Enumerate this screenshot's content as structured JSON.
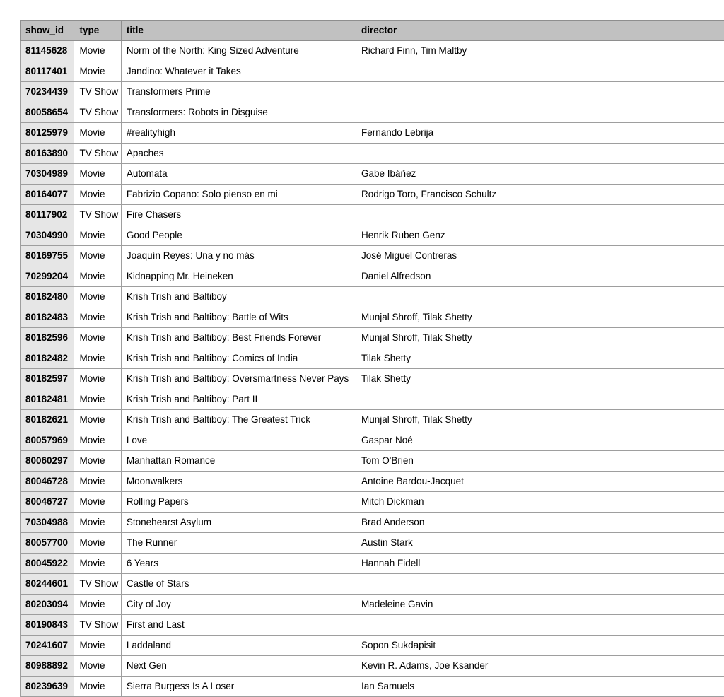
{
  "columns": [
    "show_id",
    "type",
    "title",
    "director"
  ],
  "rows": [
    {
      "show_id": "81145628",
      "type": "Movie",
      "title": "Norm of the North: King Sized Adventure",
      "director": "Richard Finn, Tim Maltby"
    },
    {
      "show_id": "80117401",
      "type": "Movie",
      "title": "Jandino: Whatever it Takes",
      "director": ""
    },
    {
      "show_id": "70234439",
      "type": "TV Show",
      "title": "Transformers Prime",
      "director": ""
    },
    {
      "show_id": "80058654",
      "type": "TV Show",
      "title": "Transformers: Robots in Disguise",
      "director": ""
    },
    {
      "show_id": "80125979",
      "type": "Movie",
      "title": "#realityhigh",
      "director": "Fernando Lebrija"
    },
    {
      "show_id": "80163890",
      "type": "TV Show",
      "title": "Apaches",
      "director": ""
    },
    {
      "show_id": "70304989",
      "type": "Movie",
      "title": "Automata",
      "director": "Gabe Ibáñez"
    },
    {
      "show_id": "80164077",
      "type": "Movie",
      "title": "Fabrizio Copano: Solo pienso en mi",
      "director": "Rodrigo Toro, Francisco Schultz"
    },
    {
      "show_id": "80117902",
      "type": "TV Show",
      "title": "Fire Chasers",
      "director": ""
    },
    {
      "show_id": "70304990",
      "type": "Movie",
      "title": "Good People",
      "director": "Henrik Ruben Genz"
    },
    {
      "show_id": "80169755",
      "type": "Movie",
      "title": "Joaquín Reyes: Una y no más",
      "director": "José Miguel Contreras"
    },
    {
      "show_id": "70299204",
      "type": "Movie",
      "title": "Kidnapping Mr. Heineken",
      "director": "Daniel Alfredson"
    },
    {
      "show_id": "80182480",
      "type": "Movie",
      "title": "Krish Trish and Baltiboy",
      "director": ""
    },
    {
      "show_id": "80182483",
      "type": "Movie",
      "title": "Krish Trish and Baltiboy: Battle of Wits",
      "director": "Munjal Shroff, Tilak Shetty"
    },
    {
      "show_id": "80182596",
      "type": "Movie",
      "title": "Krish Trish and Baltiboy: Best Friends Forever",
      "director": "Munjal Shroff, Tilak Shetty"
    },
    {
      "show_id": "80182482",
      "type": "Movie",
      "title": "Krish Trish and Baltiboy: Comics of India",
      "director": "Tilak Shetty"
    },
    {
      "show_id": "80182597",
      "type": "Movie",
      "title": "Krish Trish and Baltiboy: Oversmartness Never Pays",
      "director": "Tilak Shetty"
    },
    {
      "show_id": "80182481",
      "type": "Movie",
      "title": "Krish Trish and Baltiboy: Part II",
      "director": ""
    },
    {
      "show_id": "80182621",
      "type": "Movie",
      "title": "Krish Trish and Baltiboy: The Greatest Trick",
      "director": "Munjal Shroff, Tilak Shetty"
    },
    {
      "show_id": "80057969",
      "type": "Movie",
      "title": "Love",
      "director": "Gaspar Noé"
    },
    {
      "show_id": "80060297",
      "type": "Movie",
      "title": "Manhattan Romance",
      "director": "Tom O'Brien"
    },
    {
      "show_id": "80046728",
      "type": "Movie",
      "title": "Moonwalkers",
      "director": "Antoine Bardou-Jacquet"
    },
    {
      "show_id": "80046727",
      "type": "Movie",
      "title": "Rolling Papers",
      "director": "Mitch Dickman"
    },
    {
      "show_id": "70304988",
      "type": "Movie",
      "title": "Stonehearst Asylum",
      "director": "Brad Anderson"
    },
    {
      "show_id": "80057700",
      "type": "Movie",
      "title": "The Runner",
      "director": "Austin Stark"
    },
    {
      "show_id": "80045922",
      "type": "Movie",
      "title": "6 Years",
      "director": "Hannah Fidell"
    },
    {
      "show_id": "80244601",
      "type": "TV Show",
      "title": "Castle of Stars",
      "director": ""
    },
    {
      "show_id": "80203094",
      "type": "Movie",
      "title": "City of Joy",
      "director": "Madeleine Gavin"
    },
    {
      "show_id": "80190843",
      "type": "TV Show",
      "title": "First and Last",
      "director": ""
    },
    {
      "show_id": "70241607",
      "type": "Movie",
      "title": "Laddaland",
      "director": "Sopon Sukdapisit"
    },
    {
      "show_id": "80988892",
      "type": "Movie",
      "title": "Next Gen",
      "director": "Kevin R. Adams, Joe Ksander"
    },
    {
      "show_id": "80239639",
      "type": "Movie",
      "title": "Sierra Burgess Is A Loser",
      "director": "Ian Samuels"
    }
  ]
}
